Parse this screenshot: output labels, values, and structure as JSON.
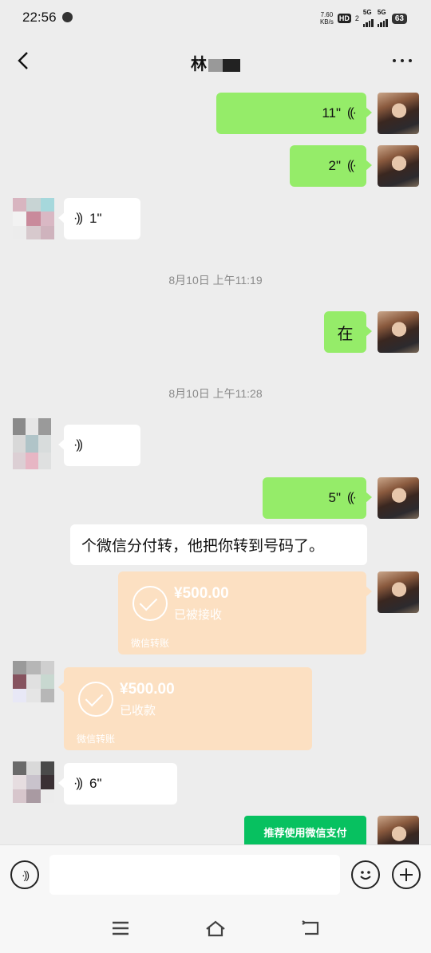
{
  "status_bar": {
    "time": "22:56",
    "speed_value": "7.60",
    "speed_unit": "KB/s",
    "hd": "HD",
    "hd_sub": "2",
    "net1": "5G",
    "net2": "5G",
    "battery": "63"
  },
  "header": {
    "title": "林",
    "back_icon": "chevron-left-icon",
    "more_icon": "more-horizontal-icon"
  },
  "messages": {
    "m1": "11\"",
    "m2": "2\"",
    "m3": "1\"",
    "ts1": "8月10日 上午11:19",
    "m4": "在",
    "ts2": "8月10日 上午11:28",
    "m6": "5\"",
    "m7": "个微信分付转，他把你转到号码了。",
    "t1_amount": "¥500.00",
    "t1_state": "已被接收",
    "t1_label": "微信转账",
    "t2_amount": "¥500.00",
    "t2_state": "已收款",
    "t2_label": "微信转账",
    "m9": "6\"",
    "pay_banner": "推荐使用微信支付"
  },
  "input_bar": {
    "voice_icon": "voice-icon",
    "emoji_icon": "emoji-icon",
    "plus_icon": "plus-icon"
  },
  "colors": {
    "green_bubble": "#95ec69",
    "transfer": "#fce0c2",
    "pay_green": "#07c160",
    "background": "#ededed"
  }
}
